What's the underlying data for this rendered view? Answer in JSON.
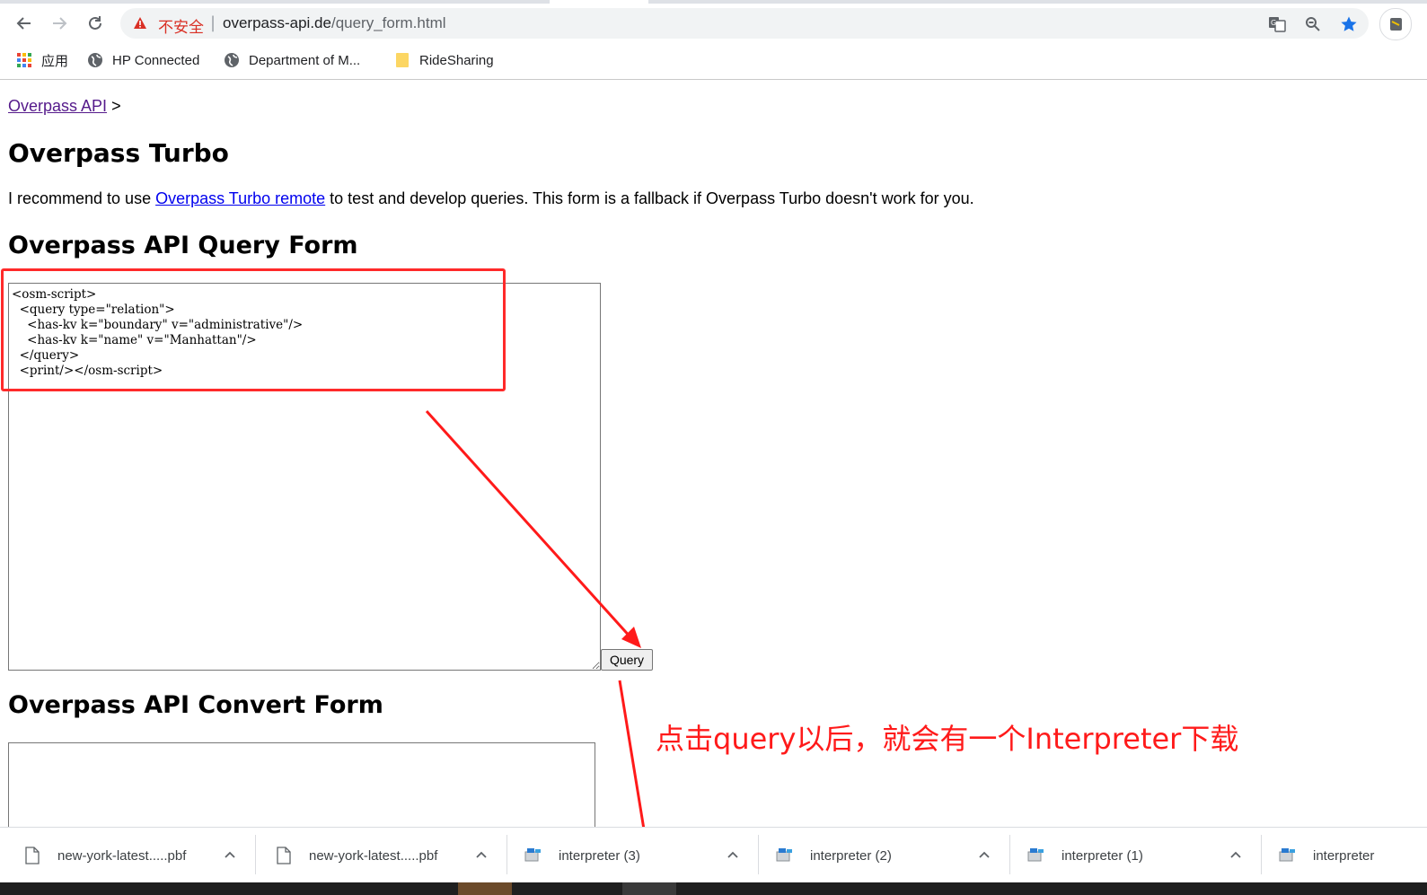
{
  "browser": {
    "security_label": "不安全",
    "url_host": "overpass-api.de",
    "url_path": "/query_form.html",
    "bookmarks": [
      {
        "label": "应用",
        "icon": "apps-grid-icon"
      },
      {
        "label": "HP Connected",
        "icon": "globe-icon"
      },
      {
        "label": "Department of M...",
        "icon": "globe-icon"
      },
      {
        "label": "RideSharing",
        "icon": "folder-icon"
      }
    ]
  },
  "page": {
    "breadcrumb_link": "Overpass API",
    "breadcrumb_sep": ">",
    "heading_turbo": "Overpass Turbo",
    "intro_before": "I recommend to use ",
    "intro_link": "Overpass Turbo remote",
    "intro_after": " to test and develop queries. This form is a fallback if Overpass Turbo doesn't work for you.",
    "heading_query": "Overpass API Query Form",
    "query_text": "<osm-script>\n  <query type=\"relation\">\n    <has-kv k=\"boundary\" v=\"administrative\"/>\n    <has-kv k=\"name\" v=\"Manhattan\"/>\n  </query>\n  <print/></osm-script>",
    "query_button": "Query",
    "heading_convert": "Overpass API Convert Form",
    "convert_text": ""
  },
  "annotation": {
    "note": "点击query以后，就会有一个Interpreter下载",
    "color": "#ff1a1a"
  },
  "downloads": [
    {
      "name": "new-york-latest.....pbf",
      "icon": "file-icon"
    },
    {
      "name": "new-york-latest.....pbf",
      "icon": "file-icon"
    },
    {
      "name": "interpreter (3)",
      "icon": "generic-file-icon"
    },
    {
      "name": "interpreter (2)",
      "icon": "generic-file-icon"
    },
    {
      "name": "interpreter (1)",
      "icon": "generic-file-icon"
    },
    {
      "name": "interpreter",
      "icon": "generic-file-icon"
    }
  ]
}
